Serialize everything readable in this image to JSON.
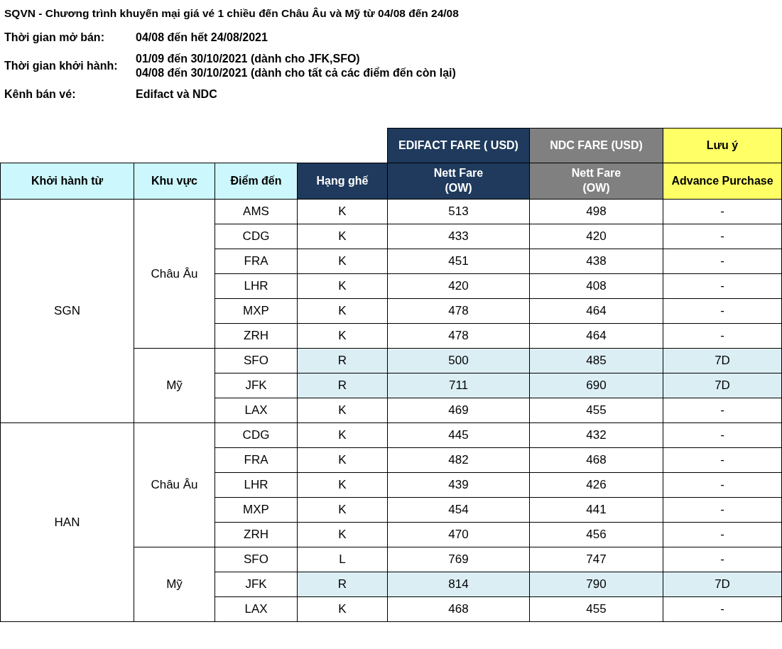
{
  "title": "SQVN - Chương trình khuyến mại giá vé 1 chiều đến Châu Âu và Mỹ từ 04/08 đến 24/08",
  "info": [
    {
      "label": "Thời gian mở bán:",
      "values": [
        "04/08 đến hết 24/08/2021"
      ]
    },
    {
      "label": "Thời gian khởi hành:",
      "values": [
        "01/09 đến 30/10/2021 (dành cho JFK,SFO)",
        "04/08 đến 30/10/2021 (dành cho tất cả các điểm đến còn lại)"
      ]
    },
    {
      "label": "Kênh bán vé:",
      "values": [
        "Edifact và NDC"
      ]
    }
  ],
  "table": {
    "group_headers": [
      {
        "label": "EDIFACT FARE ( USD)",
        "kind": "dark"
      },
      {
        "label": "NDC FARE (USD)",
        "kind": "gray"
      },
      {
        "label": "Lưu ý",
        "kind": "yellow"
      }
    ],
    "columns": [
      {
        "label": "Khởi hành từ",
        "kind": "light"
      },
      {
        "label": "Khu vực",
        "kind": "light"
      },
      {
        "label": "Điểm đến",
        "kind": "light"
      },
      {
        "label": "Hạng ghế",
        "kind": "dark"
      },
      {
        "label": "Nett Fare\n(OW)",
        "kind": "dark"
      },
      {
        "label": "Nett Fare\n(OW)",
        "kind": "gray"
      },
      {
        "label": "Advance Purchase",
        "kind": "yellow"
      }
    ],
    "origins": [
      {
        "name": "SGN",
        "regions": [
          {
            "name": "Châu Âu",
            "rows": [
              {
                "destination": "AMS",
                "class": "K",
                "edifact": "513",
                "ndc": "498",
                "advance": "-",
                "highlighted": false
              },
              {
                "destination": "CDG",
                "class": "K",
                "edifact": "433",
                "ndc": "420",
                "advance": "-",
                "highlighted": false
              },
              {
                "destination": "FRA",
                "class": "K",
                "edifact": "451",
                "ndc": "438",
                "advance": "-",
                "highlighted": false
              },
              {
                "destination": "LHR",
                "class": "K",
                "edifact": "420",
                "ndc": "408",
                "advance": "-",
                "highlighted": false
              },
              {
                "destination": "MXP",
                "class": "K",
                "edifact": "478",
                "ndc": "464",
                "advance": "-",
                "highlighted": false
              },
              {
                "destination": "ZRH",
                "class": "K",
                "edifact": "478",
                "ndc": "464",
                "advance": "-",
                "highlighted": false
              }
            ]
          },
          {
            "name": "Mỹ",
            "rows": [
              {
                "destination": "SFO",
                "class": "R",
                "edifact": "500",
                "ndc": "485",
                "advance": "7D",
                "highlighted": true
              },
              {
                "destination": "JFK",
                "class": "R",
                "edifact": "711",
                "ndc": "690",
                "advance": "7D",
                "highlighted": true
              },
              {
                "destination": "LAX",
                "class": "K",
                "edifact": "469",
                "ndc": "455",
                "advance": "-",
                "highlighted": false
              }
            ]
          }
        ]
      },
      {
        "name": "HAN",
        "regions": [
          {
            "name": "Châu Âu",
            "rows": [
              {
                "destination": "CDG",
                "class": "K",
                "edifact": "445",
                "ndc": "432",
                "advance": "-",
                "highlighted": false
              },
              {
                "destination": "FRA",
                "class": "K",
                "edifact": "482",
                "ndc": "468",
                "advance": "-",
                "highlighted": false
              },
              {
                "destination": "LHR",
                "class": "K",
                "edifact": "439",
                "ndc": "426",
                "advance": "-",
                "highlighted": false
              },
              {
                "destination": "MXP",
                "class": "K",
                "edifact": "454",
                "ndc": "441",
                "advance": "-",
                "highlighted": false
              },
              {
                "destination": "ZRH",
                "class": "K",
                "edifact": "470",
                "ndc": "456",
                "advance": "-",
                "highlighted": false
              }
            ]
          },
          {
            "name": "Mỹ",
            "rows": [
              {
                "destination": "SFO",
                "class": "L",
                "edifact": "769",
                "ndc": "747",
                "advance": "-",
                "highlighted": false
              },
              {
                "destination": "JFK",
                "class": "R",
                "edifact": "814",
                "ndc": "790",
                "advance": "7D",
                "highlighted": true
              },
              {
                "destination": "LAX",
                "class": "K",
                "edifact": "468",
                "ndc": "455",
                "advance": "-",
                "highlighted": false
              }
            ]
          }
        ]
      }
    ]
  }
}
